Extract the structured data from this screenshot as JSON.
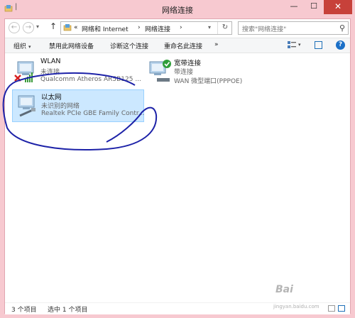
{
  "window": {
    "title": "网络连接",
    "buttons": {
      "minimize": "—",
      "maximize": "☐",
      "close": "✕"
    }
  },
  "nav": {
    "back": "←",
    "forward": "→",
    "up": "↑",
    "breadcrumb": [
      "«",
      "网络和 Internet",
      "›",
      "网络连接",
      "›"
    ],
    "refresh": "↻",
    "search_placeholder": "搜索\"网络连接\""
  },
  "commands": {
    "organize": "组织",
    "disable": "禁用此网络设备",
    "diagnose": "诊断这个连接",
    "rename": "重命名此连接",
    "more": "»"
  },
  "connections": [
    {
      "name": "WLAN",
      "status": "未连接",
      "device": "Qualcomm Atheros AR5B125 ..."
    },
    {
      "name": "宽带连接",
      "status": "带连接",
      "device": "WAN 微型端口(PPPOE)"
    },
    {
      "name": "以太网",
      "status": "未识别的网络",
      "device": "Realtek PCIe GBE Family Contr..."
    }
  ],
  "status": {
    "count": "3 个项目",
    "selected": "选中 1 个项目"
  },
  "watermark": {
    "text": "Bai",
    "sub": "jingyan.baidu.com"
  },
  "colors": {
    "accent": "#1a6fc7",
    "selection": "#cce8ff",
    "titlebar": "#f7c9d0",
    "close": "#c7413a",
    "annotation": "#1d22a8"
  }
}
